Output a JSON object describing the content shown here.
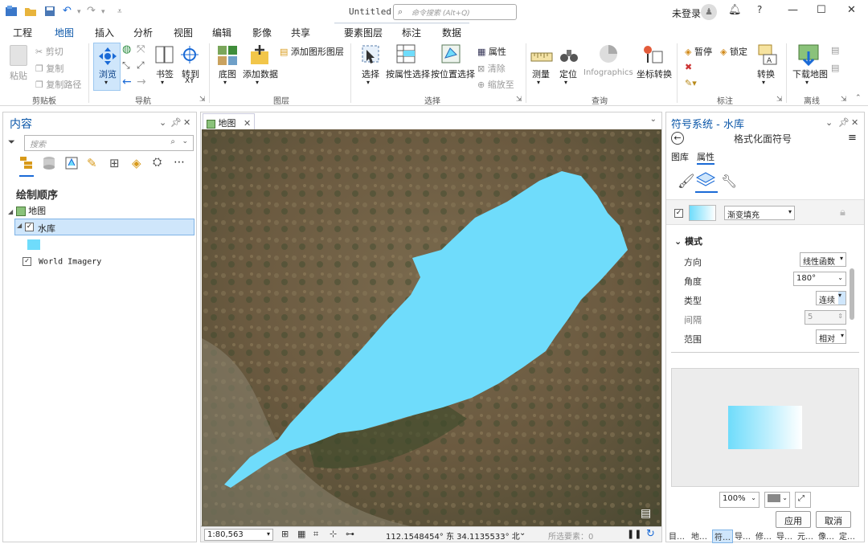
{
  "titlebar": {
    "title": "Untitled",
    "search_placeholder": "命令搜索 (Alt+Q)",
    "user": "未登录",
    "help": "?"
  },
  "tabs": [
    {
      "label": "工程"
    },
    {
      "label": "地图"
    },
    {
      "label": "插入"
    },
    {
      "label": "分析"
    },
    {
      "label": "视图"
    },
    {
      "label": "编辑"
    },
    {
      "label": "影像"
    },
    {
      "label": "共享"
    },
    {
      "label": "要素图层"
    },
    {
      "label": "标注"
    },
    {
      "label": "数据"
    }
  ],
  "ribbon": {
    "clipboard": {
      "paste": "粘贴",
      "cut": "剪切",
      "copy": "复制",
      "copy_path": "复制路径",
      "group": "剪贴板"
    },
    "navigate": {
      "explore": "浏览",
      "bookmarks": "书签",
      "goto": "转到",
      "goto_sub": "XY",
      "group": "导航"
    },
    "layer": {
      "basemap": "底图",
      "add_data": "添加数据",
      "add_graphics": "添加图形图层",
      "group": "图层"
    },
    "selection": {
      "select": "选择",
      "by_attr": "按属性选择",
      "by_location": "按位置选择",
      "attributes": "属性",
      "clear": "清除",
      "zoom_to": "缩放至",
      "group": "选择"
    },
    "inquiry": {
      "measure": "测量",
      "locate": "定位",
      "infographics": "Infographics",
      "coord": "坐标转换",
      "group": "查询"
    },
    "labeling": {
      "pause": "暂停",
      "lock": "锁定",
      "convert": "转换",
      "group": "标注"
    },
    "offline": {
      "download": "下载地图",
      "group": "离线"
    }
  },
  "contents": {
    "title": "内容",
    "search_placeholder": "搜索",
    "drawing_order": "绘制顺序",
    "map": "地图",
    "reservoir": "水库",
    "imagery": "World Imagery"
  },
  "map": {
    "tab": "地图",
    "scale": "1:80,563",
    "coords": "112.1548454° 东  34.1135533° 北",
    "selected": "所选要素：0"
  },
  "symbology": {
    "title": "符号系统 - 水库",
    "subtitle": "格式化面符号",
    "tab_gallery": "图库",
    "tab_properties": "属性",
    "fill_type": "渐变填充",
    "section": "模式",
    "rows": [
      {
        "label": "方向",
        "value": "线性函数"
      },
      {
        "label": "角度",
        "value": "180°"
      },
      {
        "label": "类型",
        "value": "连续"
      },
      {
        "label": "间隔",
        "value": "5"
      },
      {
        "label": "范围",
        "value": "相对"
      }
    ],
    "zoom": "100%",
    "apply": "应用",
    "cancel": "取消"
  },
  "bottom_tabs": [
    "目…",
    "地…",
    "符…",
    "导…",
    "修…",
    "导…",
    "元…",
    "像…",
    "定…"
  ],
  "colors": {
    "accent": "#1a6ad6",
    "water": "#6fdcfb",
    "ribbon_active": "#cfe6fb"
  }
}
